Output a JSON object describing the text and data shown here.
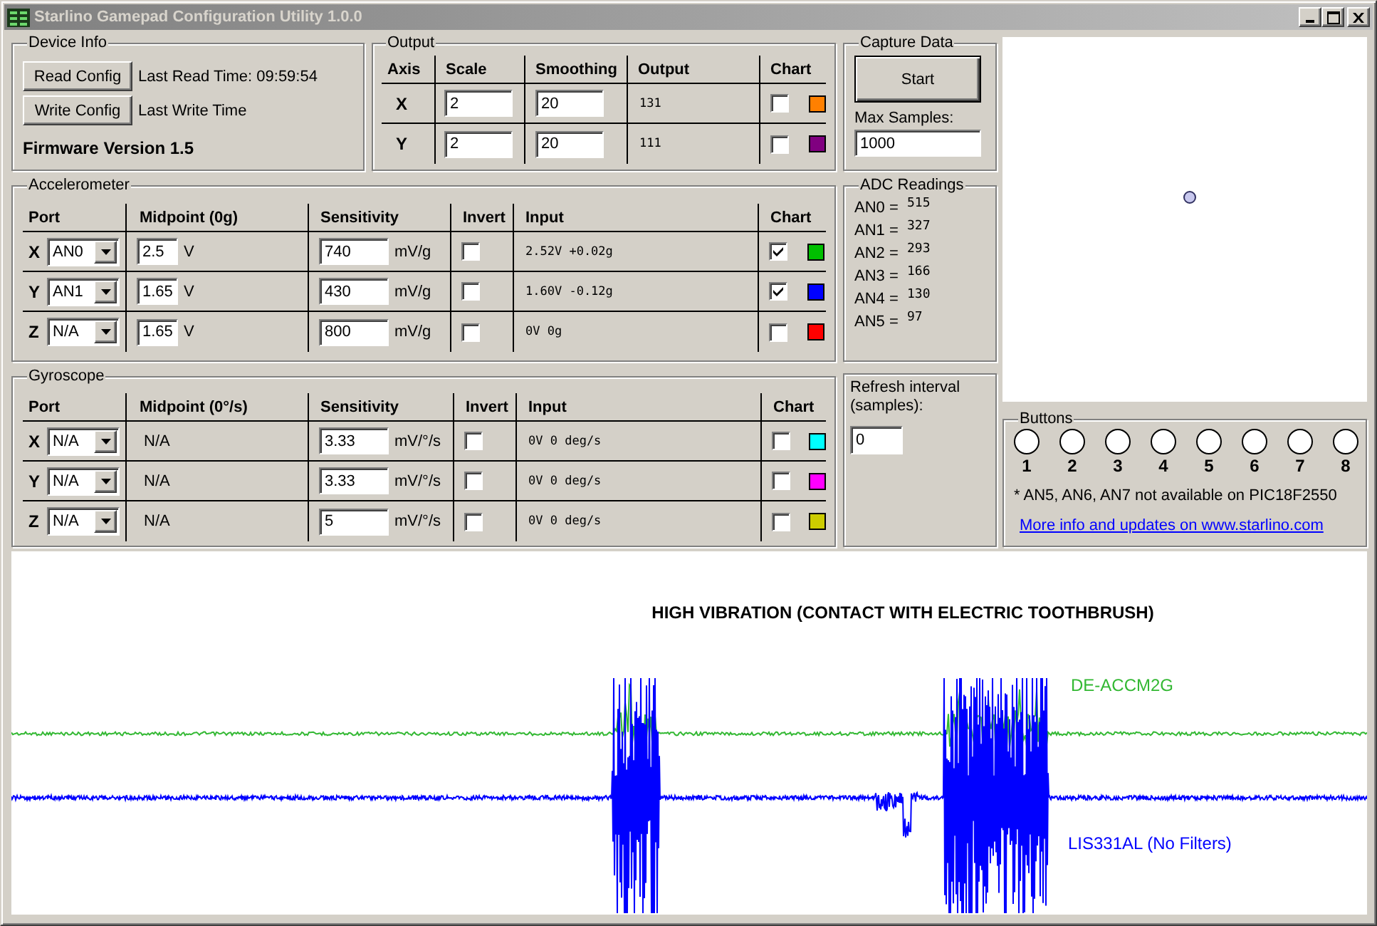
{
  "window": {
    "title": "Starlino Gamepad Configuration Utility 1.0.0"
  },
  "device_info": {
    "title": "Device Info",
    "actions": [
      {
        "button": "Read Config",
        "status": "Last Read Time: 09:59:54"
      },
      {
        "button": "Write Config",
        "status": "Last Write Time"
      }
    ],
    "firmware": "Firmware Version 1.5"
  },
  "output": {
    "title": "Output",
    "columns": [
      "Axis",
      "Scale",
      "Smoothing",
      "Output",
      "Chart"
    ],
    "rows": [
      {
        "axis": "X",
        "scale": "2",
        "smoothing": "20",
        "output": "131",
        "chart": false,
        "color": "#ff8000"
      },
      {
        "axis": "Y",
        "scale": "2",
        "smoothing": "20",
        "output": "111",
        "chart": false,
        "color": "#800080"
      }
    ]
  },
  "capture_data": {
    "title": "Capture Data",
    "button": "Start",
    "max_samples_label": "Max Samples:",
    "max_samples": "1000"
  },
  "accelerometer": {
    "title": "Accelerometer",
    "columns": [
      "Port",
      "Midpoint (0g)",
      "Sensitivity",
      "Invert",
      "Input",
      "Chart"
    ],
    "rows": [
      {
        "axis": "X",
        "port": "AN0",
        "midpoint": "2.5",
        "midpoint_unit": "V",
        "sensitivity": "740",
        "sensitivity_unit": "mV/g",
        "invert": false,
        "input": "2.52V +0.02g",
        "chart": true,
        "color": "#00c000"
      },
      {
        "axis": "Y",
        "port": "AN1",
        "midpoint": "1.65",
        "midpoint_unit": "V",
        "sensitivity": "430",
        "sensitivity_unit": "mV/g",
        "invert": false,
        "input": "1.60V -0.12g",
        "chart": true,
        "color": "#0000ff"
      },
      {
        "axis": "Z",
        "port": "N/A",
        "midpoint": "1.65",
        "midpoint_unit": "V",
        "sensitivity": "800",
        "sensitivity_unit": "mV/g",
        "invert": false,
        "input": "0V 0g",
        "chart": false,
        "color": "#ff0000"
      }
    ]
  },
  "adc_readings": {
    "title": "ADC Readings",
    "readings": [
      {
        "label": "AN0 =",
        "value": "515"
      },
      {
        "label": "AN1 =",
        "value": "327"
      },
      {
        "label": "AN2 =",
        "value": "293"
      },
      {
        "label": "AN3 =",
        "value": "166"
      },
      {
        "label": "AN4 =",
        "value": "130"
      },
      {
        "label": "AN5 =",
        "value": "97"
      }
    ]
  },
  "gyroscope": {
    "title": "Gyroscope",
    "columns": [
      "Port",
      "Midpoint (0°/s)",
      "Sensitivity",
      "Invert",
      "Input",
      "Chart"
    ],
    "rows": [
      {
        "axis": "X",
        "port": "N/A",
        "midpoint": "N/A",
        "sensitivity": "3.33",
        "sensitivity_unit": "mV/°/s",
        "invert": false,
        "input": "0V 0 deg/s",
        "chart": false,
        "color": "#00ffff"
      },
      {
        "axis": "Y",
        "port": "N/A",
        "midpoint": "N/A",
        "sensitivity": "3.33",
        "sensitivity_unit": "mV/°/s",
        "invert": false,
        "input": "0V 0 deg/s",
        "chart": false,
        "color": "#ff00ff"
      },
      {
        "axis": "Z",
        "port": "N/A",
        "midpoint": "N/A",
        "sensitivity": "5",
        "sensitivity_unit": "mV/°/s",
        "invert": false,
        "input": "0V 0 deg/s",
        "chart": false,
        "color": "#cccc00"
      }
    ]
  },
  "refresh": {
    "label": "Refresh interval (samples):",
    "value": "0"
  },
  "buttons": {
    "title": "Buttons",
    "items": [
      {
        "label": "1",
        "on": false
      },
      {
        "label": "2",
        "on": false
      },
      {
        "label": "3",
        "on": false
      },
      {
        "label": "4",
        "on": false
      },
      {
        "label": "5",
        "on": false
      },
      {
        "label": "6",
        "on": false
      },
      {
        "label": "7",
        "on": false
      },
      {
        "label": "8",
        "on": false
      }
    ],
    "note": "* AN5, AN6, AN7 not available on PIC18F2550",
    "link": "More info and updates on www.starlino.com"
  },
  "chart": {
    "title": "HIGH VIBRATION (CONTACT WITH ELECTRIC TOOTHBRUSH)",
    "series": [
      {
        "name": "DE-ACCM2G",
        "color": "#33b833"
      },
      {
        "name": "LIS331AL (No Filters)",
        "color": "#0000ff"
      }
    ]
  }
}
